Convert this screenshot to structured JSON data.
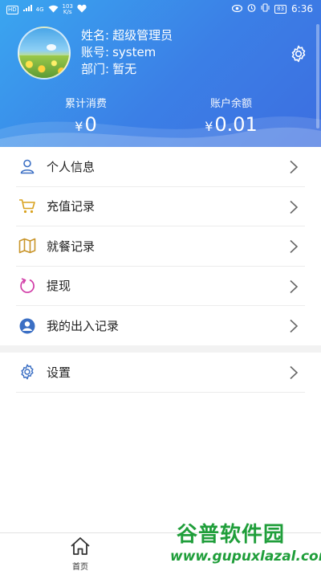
{
  "status_bar": {
    "network_badge": "HD",
    "signal": "4G",
    "speed_value": "103",
    "speed_unit": "K/s",
    "battery": "83",
    "time": "6:36"
  },
  "profile": {
    "name_label": "姓名:",
    "name_value": "超级管理员",
    "account_label": "账号:",
    "account_value": "system",
    "dept_label": "部门:",
    "dept_value": "暂无"
  },
  "stats": {
    "total_spent_label": "累计消费",
    "total_spent_currency": "¥",
    "total_spent_value": "0",
    "balance_label": "账户余额",
    "balance_currency": "¥",
    "balance_value": "0.01"
  },
  "menu": {
    "items": [
      {
        "label": "个人信息",
        "icon": "person-icon",
        "color": "#3b6fc4"
      },
      {
        "label": "充值记录",
        "icon": "cart-icon",
        "color": "#d9a21f"
      },
      {
        "label": "就餐记录",
        "icon": "map-icon",
        "color": "#c9952a"
      },
      {
        "label": "提现",
        "icon": "refresh-icon",
        "color": "#d23ea8"
      },
      {
        "label": "我的出入记录",
        "icon": "user-circle-icon",
        "color": "#3b6fc4"
      }
    ],
    "settings": {
      "label": "设置",
      "icon": "gear-icon",
      "color": "#3b6fc4"
    }
  },
  "bottom_nav": {
    "home_label": "首页"
  },
  "watermark": {
    "title": "谷普软件园",
    "url": "www.gupuxlazal.com"
  },
  "colors": {
    "header_start": "#3aa6f0",
    "header_end": "#3d6ee0",
    "watermark": "#1f9e3a"
  }
}
